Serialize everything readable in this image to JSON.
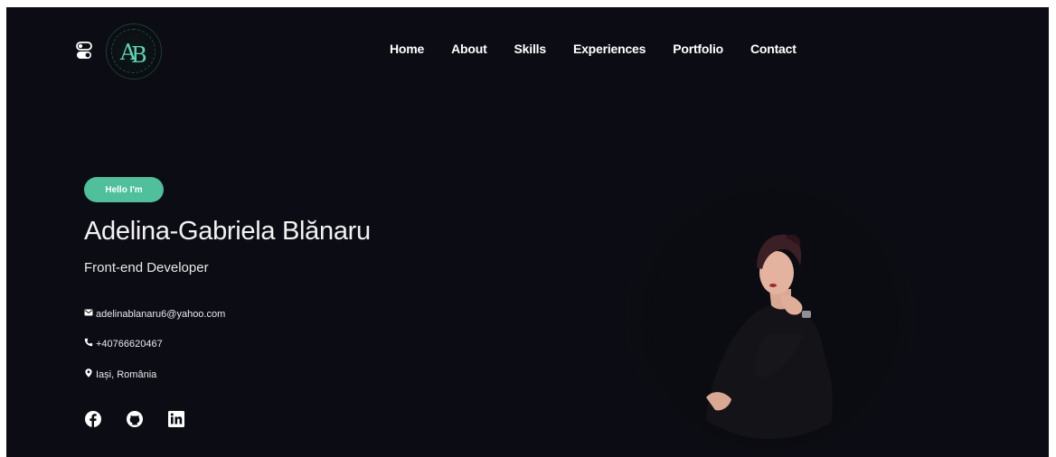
{
  "header": {
    "nav": [
      "Home",
      "About",
      "Skills",
      "Experiences",
      "Portfolio",
      "Contact"
    ]
  },
  "hero": {
    "badge": "Hello I'm",
    "name": "Adelina-Gabriela Blănaru",
    "role": "Front-end Developer",
    "email": "adelinablanaru6@yahoo.com",
    "phone": "+40766620467",
    "location": "Iași, România"
  },
  "colors": {
    "background": "#0c0d14",
    "accent": "#4fbf9c",
    "text": "#ffffff"
  },
  "icons": {
    "theme_toggle": "toggle-icon",
    "email": "envelope-icon",
    "phone": "phone-icon",
    "location": "map-pin-icon",
    "social": [
      "facebook-icon",
      "github-icon",
      "linkedin-icon"
    ]
  }
}
